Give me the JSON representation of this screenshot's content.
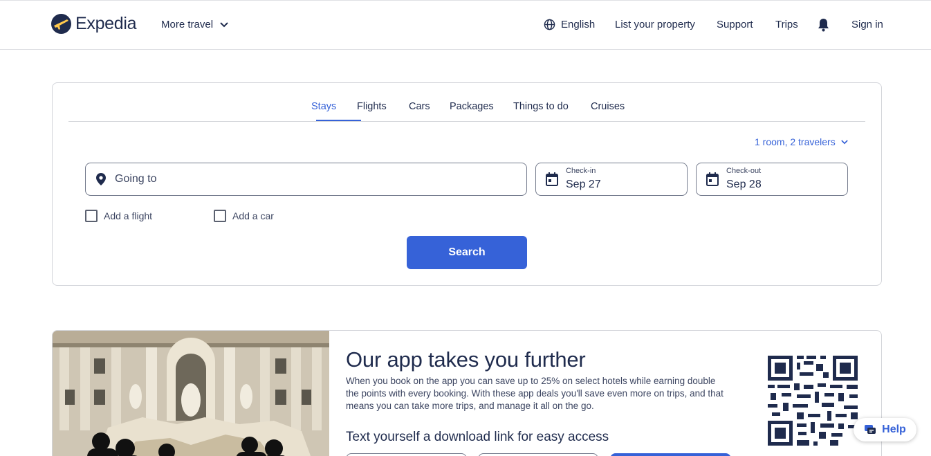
{
  "header": {
    "logo_text": "Expedia",
    "more_travel": "More travel",
    "language": "English",
    "list_property": "List your property",
    "support": "Support",
    "trips": "Trips",
    "sign_in": "Sign in"
  },
  "search": {
    "tabs": [
      {
        "label": "Stays",
        "active": true
      },
      {
        "label": "Flights",
        "active": false
      },
      {
        "label": "Cars",
        "active": false
      },
      {
        "label": "Packages",
        "active": false
      },
      {
        "label": "Things to do",
        "active": false
      },
      {
        "label": "Cruises",
        "active": false
      }
    ],
    "travelers": "1 room, 2 travelers",
    "going_to_placeholder": "Going to",
    "checkin": {
      "label": "Check-in",
      "value": "Sep 27"
    },
    "checkout": {
      "label": "Check-out",
      "value": "Sep 28"
    },
    "add_flight": "Add a flight",
    "add_car": "Add a car",
    "search_button": "Search"
  },
  "promo": {
    "title": "Our app takes you further",
    "description": "When you book on the app you can save up to 25% on select hotels while earning double the points with every booking. With these app deals you'll save even more on trips, and that means you can take more trips, and manage it all on the go.",
    "subtitle": "Text yourself a download link for easy access"
  },
  "help": {
    "label": "Help"
  },
  "colors": {
    "brand_navy": "#1f2b4d",
    "accent_blue": "#3662d8"
  }
}
